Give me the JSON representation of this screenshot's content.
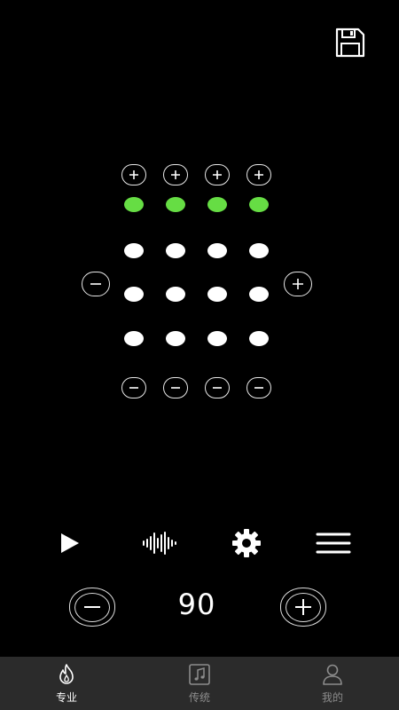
{
  "grid": {
    "columns": 4,
    "rows": [
      {
        "active": true
      },
      {
        "active": false
      },
      {
        "active": false
      },
      {
        "active": false
      }
    ],
    "accent_color": "#66dd44"
  },
  "tempo": {
    "bpm": "90"
  },
  "toolbar": {
    "icons": [
      "play-icon",
      "waveform-icon",
      "settings-icon",
      "menu-icon"
    ]
  },
  "tabs": [
    {
      "label": "专业",
      "icon": "flame-icon",
      "active": true
    },
    {
      "label": "传统",
      "icon": "music-note-icon",
      "active": false
    },
    {
      "label": "我的",
      "icon": "user-icon",
      "active": false
    }
  ]
}
